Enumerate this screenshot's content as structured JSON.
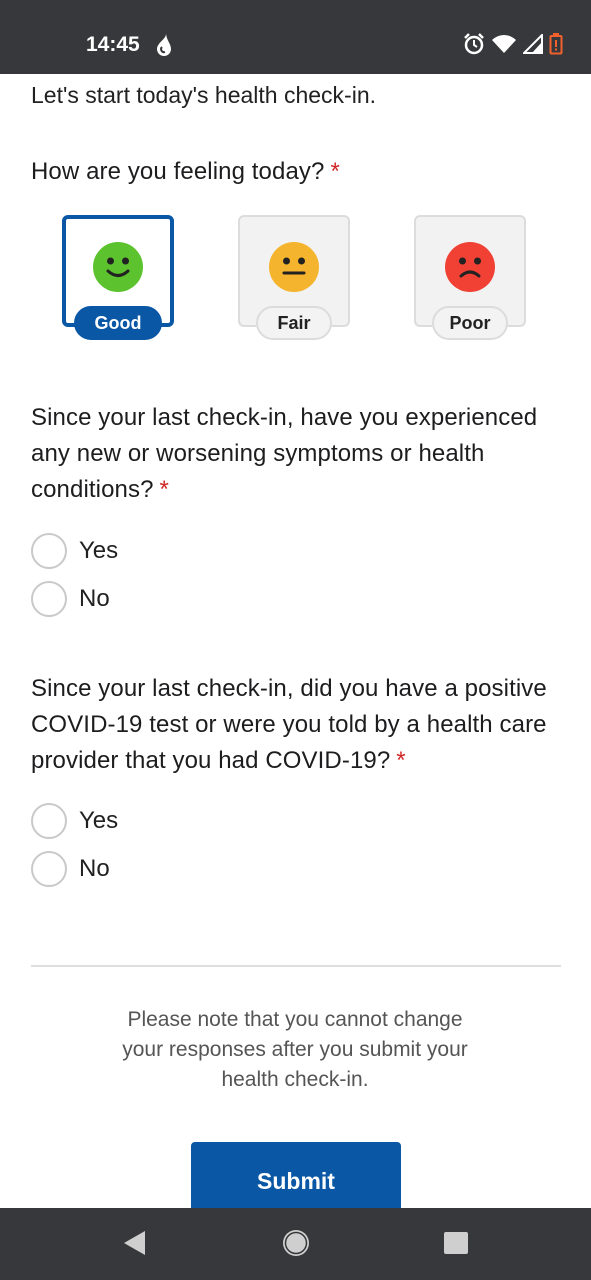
{
  "status": {
    "time": "14:45",
    "icons": [
      "drop-icon",
      "alarm-icon",
      "wifi-icon",
      "signal-icon",
      "battery-icon"
    ]
  },
  "intro": "Let's start today's health check-in.",
  "q1": {
    "title": "How are you feeling today?",
    "required": "*",
    "options": [
      {
        "label": "Good",
        "face": "happy-face-icon",
        "color": "#5cc22d",
        "selected": true
      },
      {
        "label": "Fair",
        "face": "neutral-face-icon",
        "color": "#f5b42d",
        "selected": false
      },
      {
        "label": "Poor",
        "face": "sad-face-icon",
        "color": "#f04134",
        "selected": false
      }
    ]
  },
  "q2": {
    "title_lines": [
      "Since your last check-in, have you experienced",
      "any new or worsening symptoms or health",
      "conditions?"
    ],
    "required": "*",
    "options": [
      "Yes",
      "No"
    ]
  },
  "q3": {
    "title_lines": [
      "Since your last check-in, did you have a positive",
      "COVID-19 test or were you told by a health care",
      "provider that you had COVID-19?"
    ],
    "required": "*",
    "options": [
      "Yes",
      "No"
    ]
  },
  "note_lines": [
    "Please note that you cannot change",
    "your responses after you submit your",
    "health check-in."
  ],
  "submit_label": "Submit",
  "colors": {
    "primary": "#0a57a5",
    "required": "#d12727",
    "bars": "#37383b"
  },
  "nav": [
    "back-icon",
    "home-icon",
    "recents-icon"
  ]
}
